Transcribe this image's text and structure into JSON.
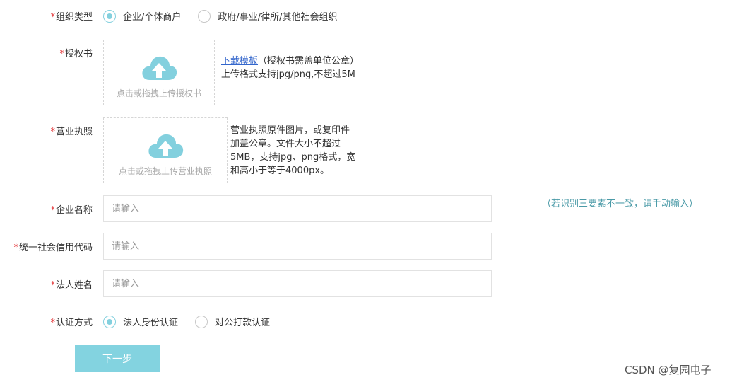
{
  "org_type": {
    "label": "组织类型",
    "required_mark": "*",
    "options": [
      "企业/个体商户",
      "政府/事业/律所/其他社会组织"
    ],
    "selected": 0
  },
  "auth_letter": {
    "label": "授权书",
    "required_mark": "*",
    "upload_text": "点击或拖拽上传授权书",
    "template_link": "下载模板",
    "note_suffix": "（授权书需盖单位公章）",
    "note_line2": "上传格式支持jpg/png,不超过5M"
  },
  "license": {
    "label": "营业执照",
    "required_mark": "*",
    "upload_text": "点击或拖拽上传营业执照",
    "note_lines": [
      "营业执照原件图片，或复印件",
      "加盖公章。文件大小不超过",
      "5MB，支持jpg、png格式，宽",
      "和高小于等于4000px。"
    ]
  },
  "company_name": {
    "label": "企业名称",
    "required_mark": "*",
    "placeholder": "请输入",
    "value": ""
  },
  "credit_code": {
    "label": "统一社会信用代码",
    "required_mark": "*",
    "placeholder": "请输入",
    "value": ""
  },
  "legal_name": {
    "label": "法人姓名",
    "required_mark": "*",
    "placeholder": "请输入",
    "value": ""
  },
  "ocr_hint": "（若识别三要素不一致，请手动输入）",
  "verify_method": {
    "label": "认证方式",
    "required_mark": "*",
    "options": [
      "法人身份认证",
      "对公打款认证"
    ],
    "selected": 0
  },
  "next_button": "下一步",
  "watermark": "CSDN @复园电子",
  "colors": {
    "accent": "#83d0de",
    "required": "#e4393c",
    "hint": "#4a9aa7",
    "link": "#3366cc"
  },
  "icons": {
    "upload": "cloud-upload-icon"
  }
}
